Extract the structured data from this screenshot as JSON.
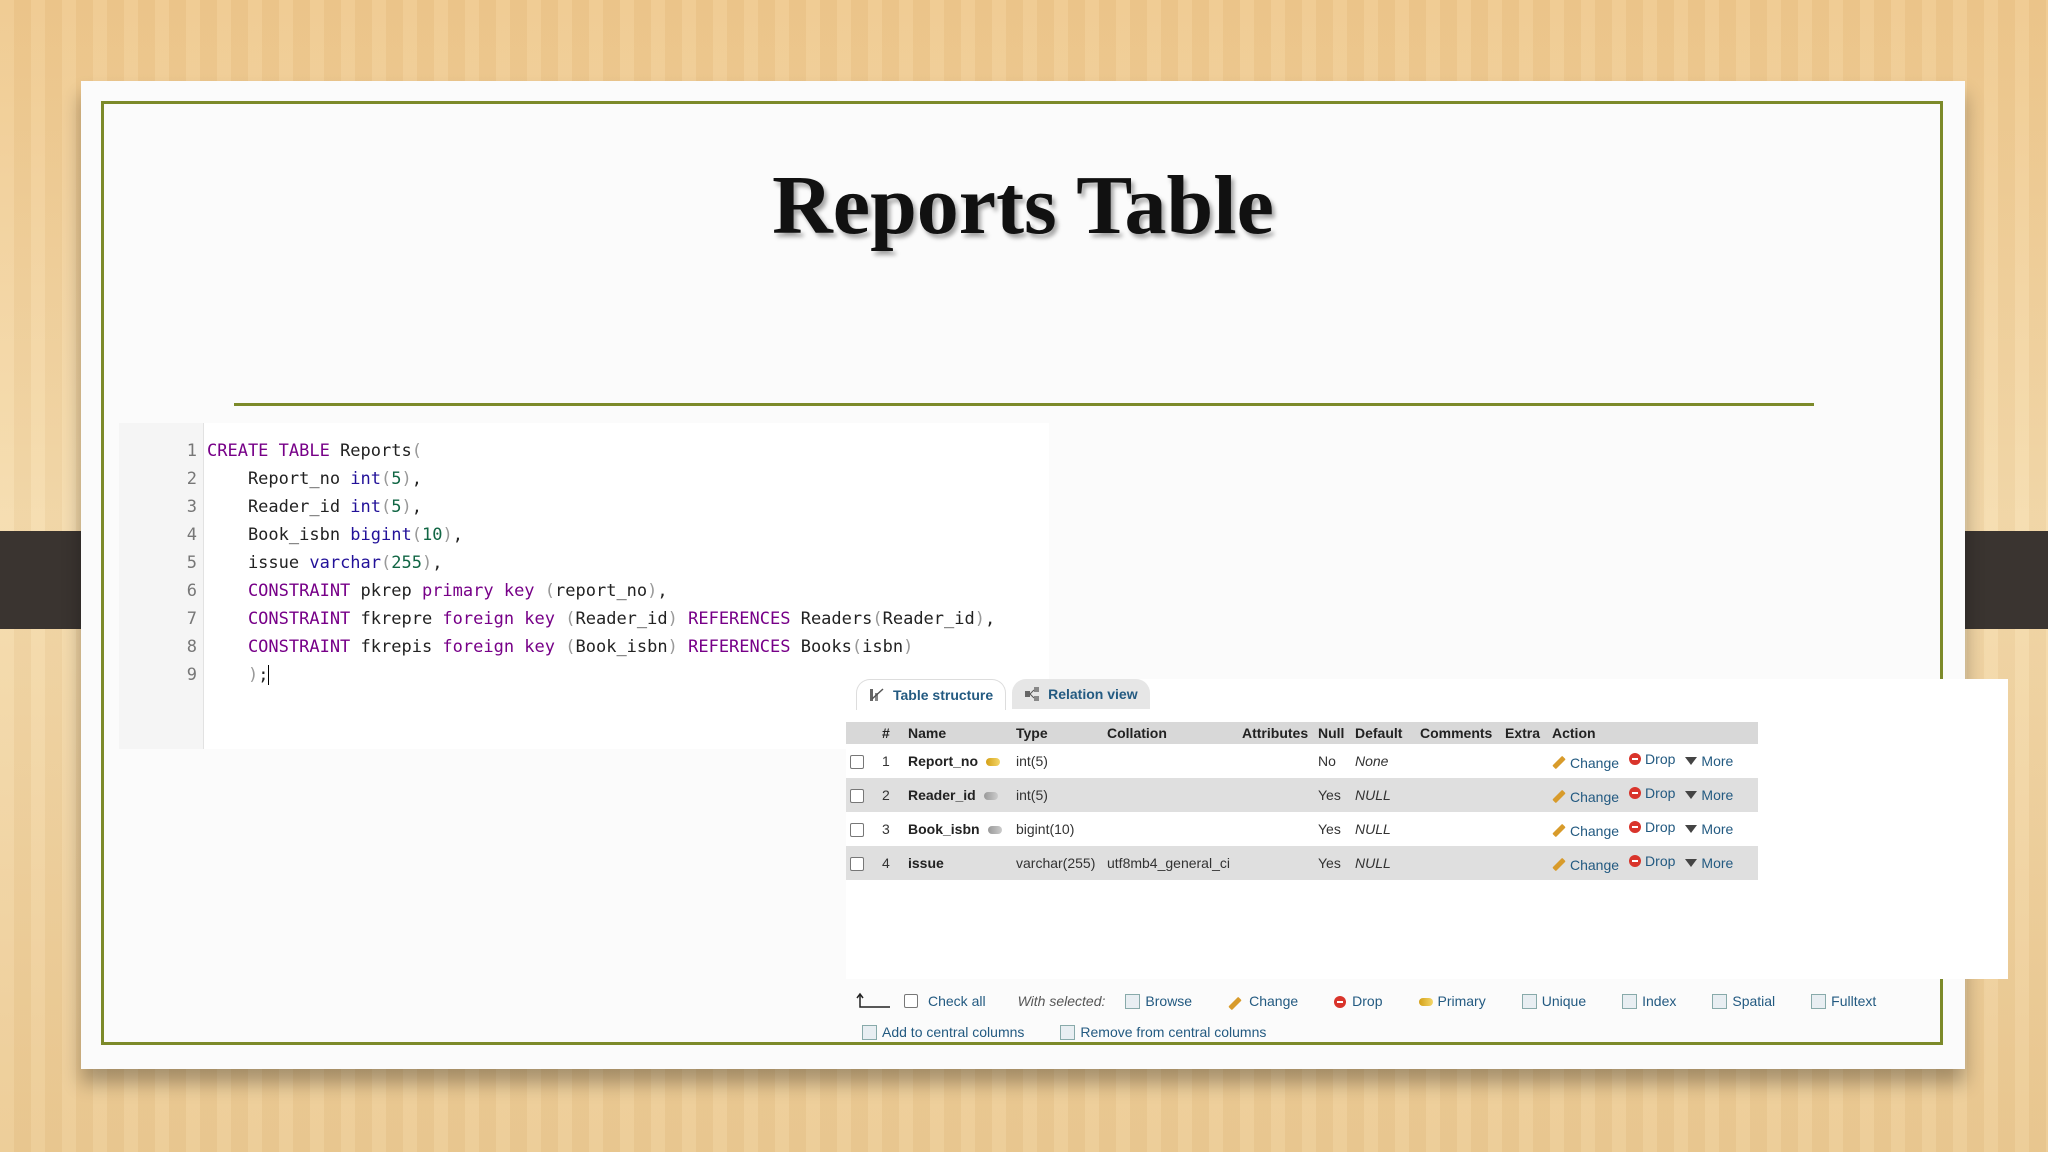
{
  "slide": {
    "title": "Reports Table"
  },
  "code_editor": {
    "lines": [
      {
        "no": "1",
        "tokens": [
          {
            "t": "CREATE TABLE",
            "c": "kw"
          },
          {
            "t": " Reports",
            "c": "nm0"
          },
          {
            "t": "(",
            "c": "br"
          }
        ]
      },
      {
        "no": "2",
        "tokens": [
          {
            "t": "    Report_no ",
            "c": "nm0"
          },
          {
            "t": "int",
            "c": "ty"
          },
          {
            "t": "(",
            "c": "br"
          },
          {
            "t": "5",
            "c": "nm"
          },
          {
            "t": ")",
            "c": "br"
          },
          {
            "t": ",",
            "c": "nm0"
          }
        ]
      },
      {
        "no": "3",
        "tokens": [
          {
            "t": "    Reader_id ",
            "c": "nm0"
          },
          {
            "t": "int",
            "c": "ty"
          },
          {
            "t": "(",
            "c": "br"
          },
          {
            "t": "5",
            "c": "nm"
          },
          {
            "t": ")",
            "c": "br"
          },
          {
            "t": ",",
            "c": "nm0"
          }
        ]
      },
      {
        "no": "4",
        "tokens": [
          {
            "t": "    Book_isbn ",
            "c": "nm0"
          },
          {
            "t": "bigint",
            "c": "ty"
          },
          {
            "t": "(",
            "c": "br"
          },
          {
            "t": "10",
            "c": "nm"
          },
          {
            "t": ")",
            "c": "br"
          },
          {
            "t": ",",
            "c": "nm0"
          }
        ]
      },
      {
        "no": "5",
        "tokens": [
          {
            "t": "    issue ",
            "c": "nm0"
          },
          {
            "t": "varchar",
            "c": "ty"
          },
          {
            "t": "(",
            "c": "br"
          },
          {
            "t": "255",
            "c": "nm"
          },
          {
            "t": ")",
            "c": "br"
          },
          {
            "t": ",",
            "c": "nm0"
          }
        ]
      },
      {
        "no": "6",
        "tokens": [
          {
            "t": "    CONSTRAINT",
            "c": "kw"
          },
          {
            "t": " pkrep ",
            "c": "nm0"
          },
          {
            "t": "primary key",
            "c": "kw"
          },
          {
            "t": " (",
            "c": "br"
          },
          {
            "t": "report_no",
            "c": "nm0"
          },
          {
            "t": ")",
            "c": "br"
          },
          {
            "t": ",",
            "c": "nm0"
          }
        ]
      },
      {
        "no": "7",
        "tokens": [
          {
            "t": "    CONSTRAINT",
            "c": "kw"
          },
          {
            "t": " fkrepre ",
            "c": "nm0"
          },
          {
            "t": "foreign key",
            "c": "kw"
          },
          {
            "t": " (",
            "c": "br"
          },
          {
            "t": "Reader_id",
            "c": "nm0"
          },
          {
            "t": ")",
            "c": "br"
          },
          {
            "t": " REFERENCES",
            "c": "kw"
          },
          {
            "t": " Readers",
            "c": "nm0"
          },
          {
            "t": "(",
            "c": "br"
          },
          {
            "t": "Reader_id",
            "c": "nm0"
          },
          {
            "t": ")",
            "c": "br"
          },
          {
            "t": ",",
            "c": "nm0"
          }
        ]
      },
      {
        "no": "8",
        "tokens": [
          {
            "t": "    CONSTRAINT",
            "c": "kw"
          },
          {
            "t": " fkrepis ",
            "c": "nm0"
          },
          {
            "t": "foreign key",
            "c": "kw"
          },
          {
            "t": " (",
            "c": "br"
          },
          {
            "t": "Book_isbn",
            "c": "nm0"
          },
          {
            "t": ")",
            "c": "br"
          },
          {
            "t": " REFERENCES",
            "c": "kw"
          },
          {
            "t": " Books",
            "c": "nm0"
          },
          {
            "t": "(",
            "c": "br"
          },
          {
            "t": "isbn",
            "c": "nm0"
          },
          {
            "t": ")",
            "c": "br"
          }
        ]
      },
      {
        "no": "9",
        "tokens": [
          {
            "t": "    )",
            "c": "br"
          },
          {
            "t": ";",
            "c": "nm0"
          }
        ]
      }
    ]
  },
  "pma": {
    "tabs": {
      "structure": "Table structure",
      "relation": "Relation view"
    },
    "headers": [
      "#",
      "Name",
      "Type",
      "Collation",
      "Attributes",
      "Null",
      "Default",
      "Comments",
      "Extra",
      "Action"
    ],
    "rows": [
      {
        "num": "1",
        "name": "Report_no",
        "key": "primary",
        "type": "int(5)",
        "collation": "",
        "attributes": "",
        "null": "No",
        "default": "None"
      },
      {
        "num": "2",
        "name": "Reader_id",
        "key": "index",
        "type": "int(5)",
        "collation": "",
        "attributes": "",
        "null": "Yes",
        "default": "NULL"
      },
      {
        "num": "3",
        "name": "Book_isbn",
        "key": "index",
        "type": "bigint(10)",
        "collation": "",
        "attributes": "",
        "null": "Yes",
        "default": "NULL"
      },
      {
        "num": "4",
        "name": "issue",
        "key": "",
        "type": "varchar(255)",
        "collation": "utf8mb4_general_ci",
        "attributes": "",
        "null": "Yes",
        "default": "NULL"
      }
    ],
    "actions": {
      "change": "Change",
      "drop": "Drop",
      "more": "More"
    },
    "bulk": {
      "check_all": "Check all",
      "with_selected": "With selected:",
      "browse": "Browse",
      "change": "Change",
      "drop": "Drop",
      "primary": "Primary",
      "unique": "Unique",
      "index": "Index",
      "spatial": "Spatial",
      "fulltext": "Fulltext",
      "add_central": "Add to central columns",
      "remove_central": "Remove from central columns"
    }
  }
}
